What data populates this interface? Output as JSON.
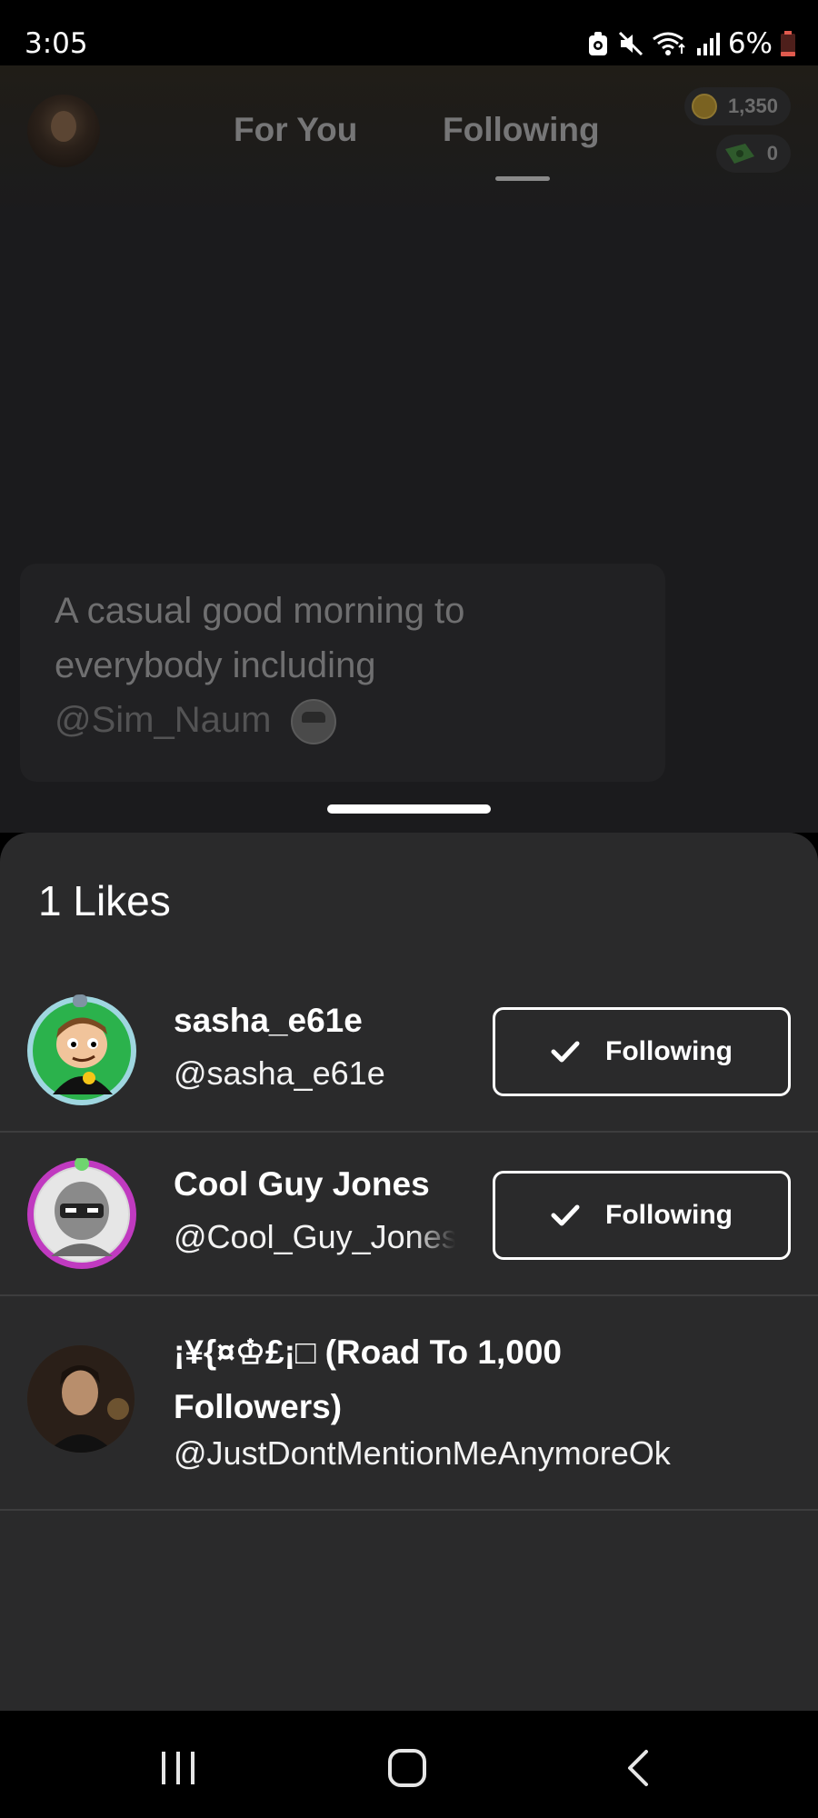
{
  "status_bar": {
    "time": "3:05",
    "battery_percent": "6%",
    "icons": [
      "screen-record-icon",
      "mute-icon",
      "wifi-icon",
      "signal-icon",
      "battery-icon"
    ]
  },
  "header": {
    "tabs": [
      {
        "label": "For You",
        "active": false
      },
      {
        "label": "Following",
        "active": true
      }
    ],
    "coins": "1,350",
    "cash": "0"
  },
  "post": {
    "caption_line1": "A casual good morning to",
    "caption_line2": "everybody including",
    "mention": "@Sim_Naum"
  },
  "likes_sheet": {
    "title": "1 Likes",
    "users": [
      {
        "name": "sasha_e61e",
        "handle": "@sasha_e61e",
        "button_label": "Following"
      },
      {
        "name": "Cool Guy Jones",
        "handle": "@Cool_Guy_Jones",
        "button_label": "Following"
      },
      {
        "name": "¡¥{¤♔£¡□ (Road To 1,000 Followers)",
        "handle": "@JustDontMentionMeAnymoreOk"
      }
    ]
  },
  "colors": {
    "sheet_background": "#2a2a2b",
    "feed_background": "#1b1b1d",
    "text_primary": "#ffffff",
    "divider": "#3d3d3e"
  }
}
